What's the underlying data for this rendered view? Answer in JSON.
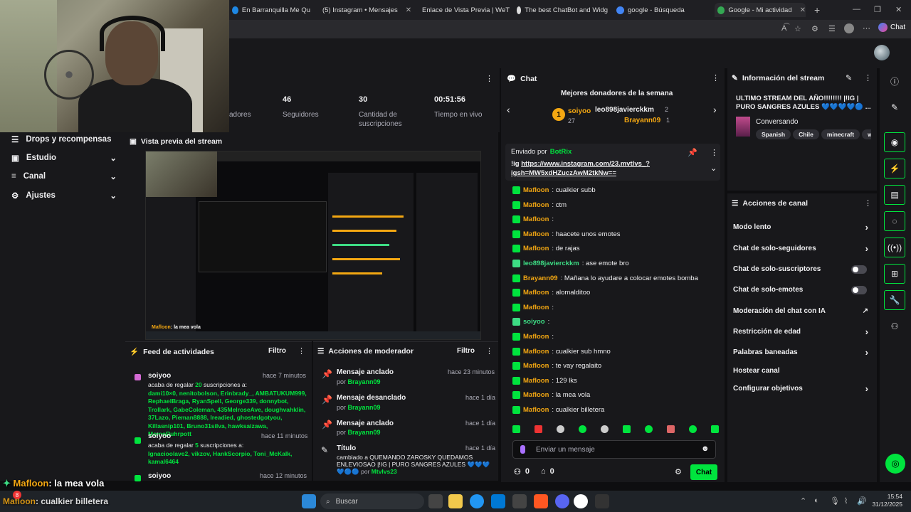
{
  "browser": {
    "tabs": [
      {
        "label": "En Barranquilla Me Qu",
        "color": "#1e88e5"
      },
      {
        "label": "(5) Instagram • Mensajes",
        "color": "#d6249f"
      },
      {
        "label": "Enlace de Vista Previa | WeT",
        "color": "#888888"
      },
      {
        "label": "The best ChatBot and Widg",
        "color": "#dddddd"
      },
      {
        "label": "google - Búsqueda",
        "color": "#4285f4"
      },
      {
        "label": "Google - Mi actividad",
        "color": "#34a853"
      }
    ],
    "new_tab": "+",
    "chat_button": "Chat"
  },
  "stats": [
    {
      "value": "",
      "label": "adores"
    },
    {
      "value": "46",
      "label": "Seguidores"
    },
    {
      "value": "30",
      "label": "Cantidad de suscripciones"
    },
    {
      "value": "00:51:56",
      "label": "Tiempo en vivo"
    }
  ],
  "leftnav": {
    "items": [
      {
        "label": "Drops y recompensas",
        "icon": "gift-icon",
        "chevron": false
      },
      {
        "label": "Estudio",
        "icon": "studio-icon",
        "chevron": true
      },
      {
        "label": "Canal",
        "icon": "channel-icon",
        "chevron": true
      },
      {
        "label": "Ajustes",
        "icon": "gear-icon",
        "chevron": true
      }
    ]
  },
  "preview": {
    "title": "Vista previa del stream",
    "overlay_user": "Mafloon",
    "overlay_msg": ": la mea vola"
  },
  "feed": {
    "title": "Feed de actividades",
    "filter": "Filtro",
    "items": [
      {
        "user": "soiyoo",
        "time": "hace 7 minutos",
        "text": "acaba de regalar ",
        "count": "20",
        "suffix": " suscripciones a:",
        "names": "dami10×0, nenitobolson, Erinbrady_, AMBATUKUM999, RephaelBraga, RyanSpell, George339, donnybot, Trollark, GabeColeman, 435MelroseAve, doughvahklin, 37Lazo, Pieman8888, Ireadied, ghostedgotyou, Killasnip101, Bruno31silva, hawksaizawa, MomoRuhrpott"
      },
      {
        "user": "soiyoo",
        "time": "hace 11 minutos",
        "text": "acaba de regalar ",
        "count": "5",
        "suffix": " suscripciones a:",
        "names": "Ignacioolave2, vikzov, HankScorpio, Toni_McKalk, kamal6464"
      },
      {
        "user": "soiyoo",
        "time": "hace 12 minutos",
        "text": "",
        "count": "",
        "suffix": "",
        "names": ""
      }
    ]
  },
  "modactions": {
    "title": "Acciones de moderador",
    "filter": "Filtro",
    "items": [
      {
        "title": "Mensaje anclado",
        "by": "por ",
        "user": "Brayann09",
        "time": "hace 23 minutos"
      },
      {
        "title": "Mensaje desanclado",
        "by": "por ",
        "user": "Brayann09",
        "time": "hace 1 día"
      },
      {
        "title": "Mensaje anclado",
        "by": "por ",
        "user": "Brayann09",
        "time": "hace 1 día"
      },
      {
        "title": "Título",
        "by": "por ",
        "user": "Mtvlvs23",
        "time": "hace 1 día",
        "desc": "cambiado a QUEMANDO ZAROSKY QUEDAMOS ENLEVIOSAO |!IG | PURO SANGRES AZULES 💙💙💙💙🔵🔵"
      }
    ]
  },
  "chat": {
    "title": "Chat",
    "donors_title": "Mejores donadores de la semana",
    "donors": [
      {
        "rank": "1",
        "name": "soiyoo",
        "count": "27"
      },
      {
        "name": "leo898javierckkm",
        "count": "2"
      },
      {
        "name": "Brayann09",
        "count": "1"
      }
    ],
    "pinned": {
      "sent_by": "Enviado por",
      "bot": "BotRix",
      "prefix": "!ig ",
      "link": "https://www.instagram.com/23.mvtlvs_?igsh=MW5xdHZuczAwM2tkNw=="
    },
    "messages": [
      {
        "user": "Mafloon",
        "text": ": cualkier subb"
      },
      {
        "user": "Mafloon",
        "text": ": ctm"
      },
      {
        "user": "Mafloon",
        "text": ":"
      },
      {
        "user": "Mafloon",
        "text": ": haacete unos emotes"
      },
      {
        "user": "Mafloon",
        "text": ": de rajas"
      },
      {
        "user": "leo898javierckkm",
        "text": ": ase emote bro",
        "green": true
      },
      {
        "user": "Brayann09",
        "text": ": Mañana lo ayudare a colocar emotes bomba"
      },
      {
        "user": "Mafloon",
        "text": ": alomalditoo"
      },
      {
        "user": "Mafloon",
        "text": ":"
      },
      {
        "user": "soiyoo",
        "text": ":",
        "green": true
      },
      {
        "user": "Mafloon",
        "text": ":"
      },
      {
        "user": "Mafloon",
        "text": ": cualkier sub hmno"
      },
      {
        "user": "Mafloon",
        "text": ": te vay regalaito"
      },
      {
        "user": "Mafloon",
        "text": ": 129 lks"
      },
      {
        "user": "Mafloon",
        "text": ": la mea vola"
      },
      {
        "user": "Mafloon",
        "text": ": cualkier billetera"
      }
    ],
    "input_placeholder": "Enviar un mensaje",
    "points": "0",
    "send_label": "Chat"
  },
  "streaminfo": {
    "title": "Información del stream",
    "stream_title": "ULTIMO STREAM DEL AÑO!!!!!!!! |!IG | PURO SANGRES AZULES 💙💙💙💙🔵 ...",
    "category": "Conversando",
    "tags": [
      "Spanish",
      "Chile",
      "minecraft",
      "weed"
    ]
  },
  "chanactions": {
    "title": "Acciones de canal",
    "items": [
      {
        "label": "Modo lento",
        "kind": "chevron"
      },
      {
        "label": "Chat de solo-seguidores",
        "kind": "chevron"
      },
      {
        "label": "Chat de solo-suscriptores",
        "kind": "toggle"
      },
      {
        "label": "Chat de solo-emotes",
        "kind": "toggle"
      },
      {
        "label": "Moderación del chat con IA",
        "kind": "external"
      },
      {
        "label": "Restricción de edad",
        "kind": "chevron"
      },
      {
        "label": "Palabras baneadas",
        "kind": "chevron"
      },
      {
        "label": "Hostear canal",
        "kind": "none"
      },
      {
        "label": "Configurar objetivos",
        "kind": "chevron"
      }
    ]
  },
  "overlay": {
    "line1_user": "Mafloon",
    "line1_text": ": la mea vola",
    "line2_user": "Mafloon",
    "line2_text": ": cualkier billetera"
  },
  "taskbar": {
    "search": "Buscar",
    "time": "15:54",
    "date": "31/12/2025",
    "badge": "8"
  },
  "colors": {
    "accent": "#00e43e",
    "orange": "#f3a712",
    "bg": "#18181b"
  }
}
